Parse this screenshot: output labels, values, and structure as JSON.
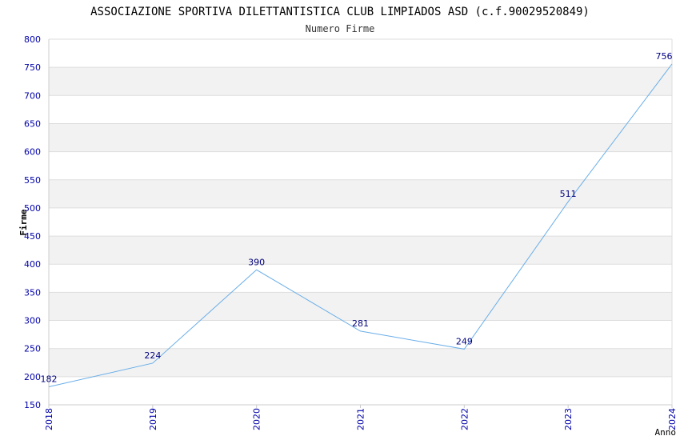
{
  "chart_data": {
    "type": "line",
    "title": "ASSOCIAZIONE SPORTIVA DILETTANTISTICA CLUB LIMPIADOS ASD (c.f.90029520849)",
    "subtitle": "Numero Firme",
    "xlabel": "Anno",
    "ylabel": "Firme",
    "categories": [
      "2018",
      "2019",
      "2020",
      "2021",
      "2022",
      "2023",
      "2024"
    ],
    "series": [
      {
        "values": [
          182,
          224,
          390,
          281,
          249,
          511,
          756
        ]
      }
    ],
    "ylim": [
      150,
      800
    ],
    "yticks": [
      150,
      200,
      250,
      300,
      350,
      400,
      450,
      500,
      550,
      600,
      650,
      700,
      750,
      800
    ],
    "grid": true,
    "colors": {
      "line": "#6aaee8",
      "tick_label": "#0000aa",
      "data_label": "#000080",
      "band": "#f2f2f2",
      "grid": "#dddddd",
      "axis": "#cccccc",
      "title": "#000000",
      "subtitle": "#333333"
    }
  }
}
